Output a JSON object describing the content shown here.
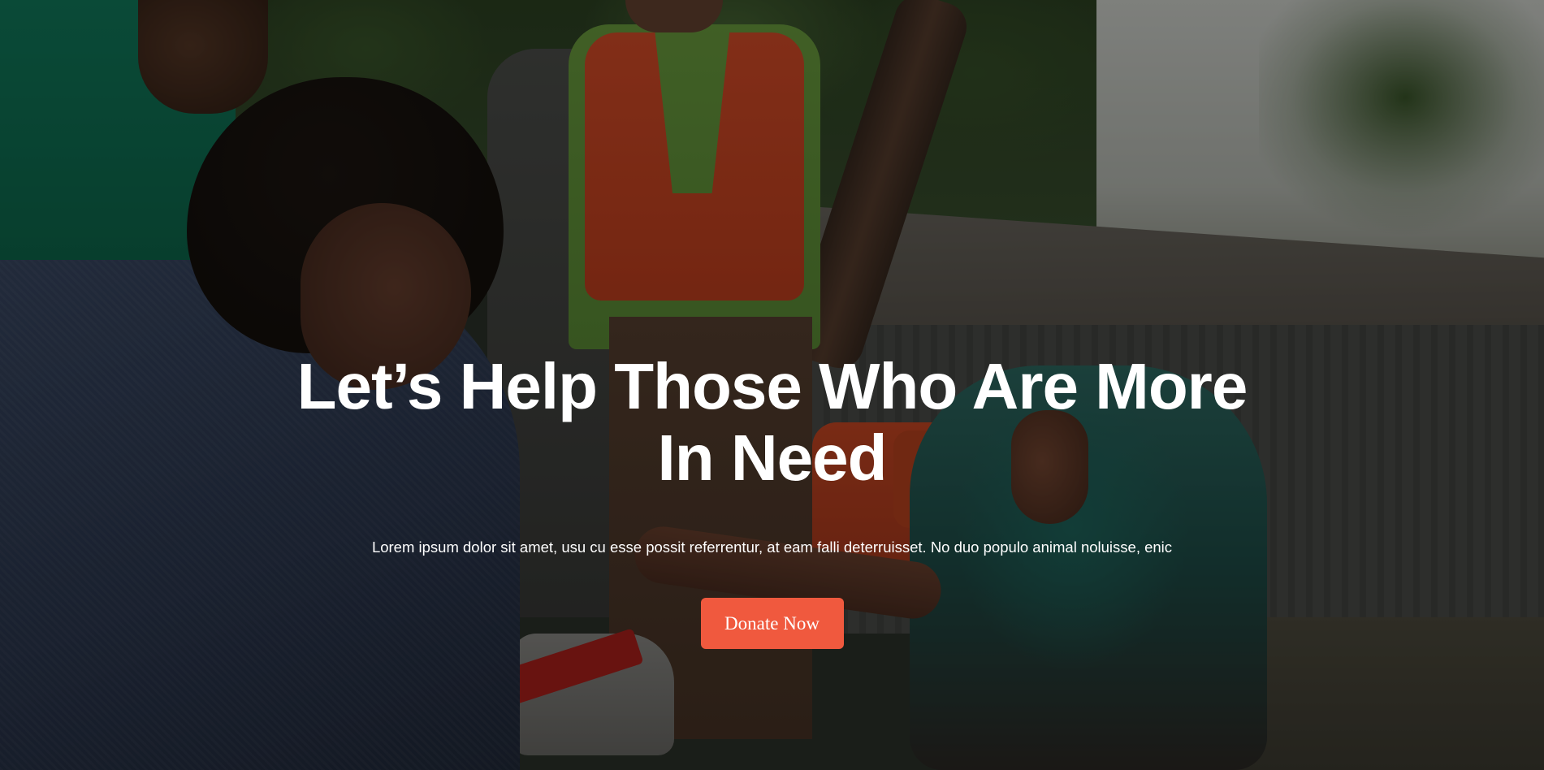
{
  "hero": {
    "headline": "Let’s Help Those Who Are More In Need",
    "subtitle": "Lorem ipsum dolor sit amet, usu cu esse possit referrentur, at eam falli deterruisset. No duo populo animal noluisse, enic",
    "donate_label": "Donate Now"
  },
  "colors": {
    "accent": "#f0593e",
    "text": "#ffffff"
  }
}
